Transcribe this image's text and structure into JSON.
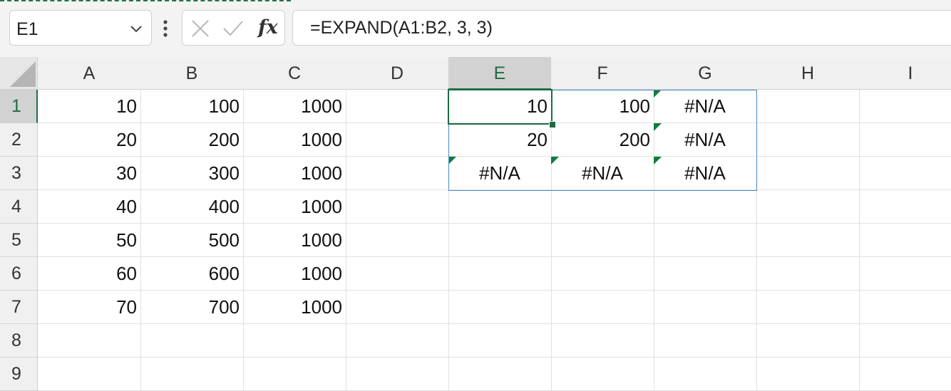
{
  "name_box": {
    "value": "E1"
  },
  "formula_bar": {
    "formula": "=EXPAND(A1:B2, 3, 3)",
    "fx_label": "fx"
  },
  "icons": {
    "name_box_dropdown": "chevron-down-icon",
    "more": "vertical-dots-icon",
    "cancel": "cancel-icon",
    "enter": "enter-icon",
    "insert_function": "fx-icon",
    "select_all": "select-all-icon"
  },
  "colors": {
    "selection_green": "#217346",
    "error_indicator": "#107c41",
    "spill_border": "#4a8ac6"
  },
  "grid": {
    "columns": [
      "A",
      "B",
      "C",
      "D",
      "E",
      "F",
      "G",
      "H",
      "I"
    ],
    "rows": [
      "1",
      "2",
      "3",
      "4",
      "5",
      "6",
      "7",
      "8",
      "9"
    ],
    "selected_column": "E",
    "selected_row": "1",
    "cells": [
      [
        "10",
        "100",
        "1000",
        "",
        "10",
        "100",
        "#N/A",
        "",
        ""
      ],
      [
        "20",
        "200",
        "1000",
        "",
        "20",
        "200",
        "#N/A",
        "",
        ""
      ],
      [
        "30",
        "300",
        "1000",
        "",
        "#N/A",
        "#N/A",
        "#N/A",
        "",
        ""
      ],
      [
        "40",
        "400",
        "1000",
        "",
        "",
        "",
        "",
        "",
        ""
      ],
      [
        "50",
        "500",
        "1000",
        "",
        "",
        "",
        "",
        "",
        ""
      ],
      [
        "60",
        "600",
        "1000",
        "",
        "",
        "",
        "",
        "",
        ""
      ],
      [
        "70",
        "700",
        "1000",
        "",
        "",
        "",
        "",
        "",
        ""
      ],
      [
        "",
        "",
        "",
        "",
        "",
        "",
        "",
        "",
        ""
      ],
      [
        "",
        "",
        "",
        "",
        "",
        "",
        "",
        "",
        ""
      ]
    ]
  }
}
